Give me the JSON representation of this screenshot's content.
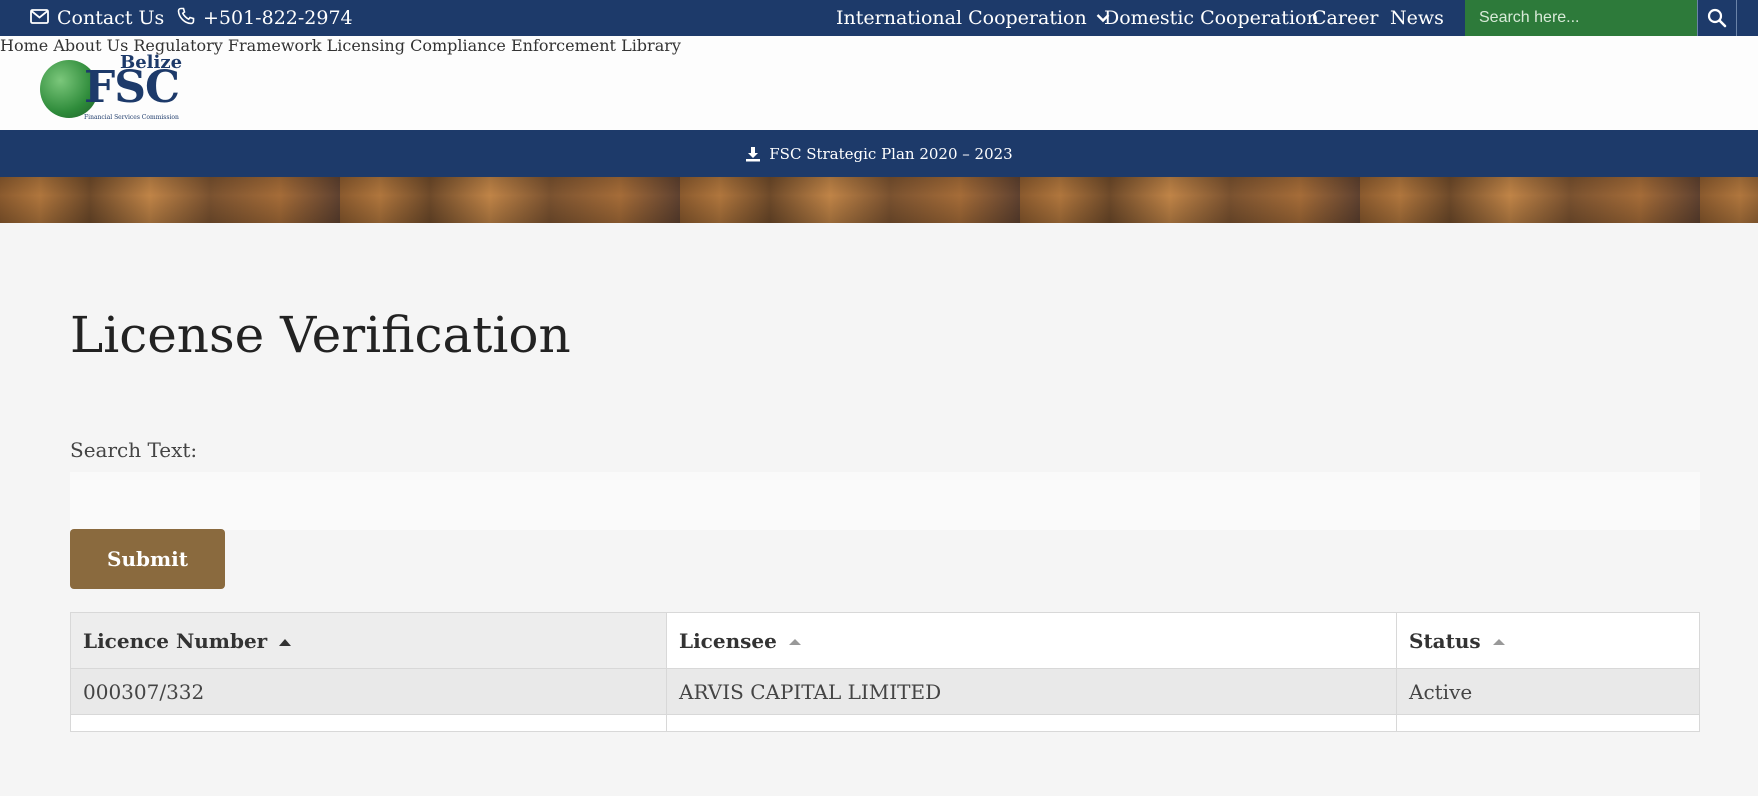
{
  "topbar": {
    "contact_label": "Contact Us",
    "phone": "+501-822-2974",
    "links": [
      "International Cooperation",
      "Domestic Cooperation",
      "Career",
      "News"
    ],
    "search_placeholder": "Search here..."
  },
  "logo": {
    "line1": "Belize",
    "line2": "FSC",
    "line3": "Financial Services Commission"
  },
  "nav": [
    "Home",
    "About Us",
    "Regulatory Framework",
    "Licensing",
    "Compliance",
    "Enforcement",
    "Library"
  ],
  "plan_link": "FSC Strategic Plan 2020 – 2023",
  "page": {
    "title": "License Verification",
    "search_label": "Search Text:",
    "search_value": "",
    "submit_label": "Submit"
  },
  "table": {
    "headers": [
      "Licence Number",
      "Licensee",
      "Status"
    ],
    "rows": [
      [
        "000307/332",
        "ARVIS CAPITAL LIMITED",
        "Active"
      ]
    ]
  },
  "colors": {
    "navy": "#1d3a6a",
    "search_green": "#2d7a3a",
    "submit_brown": "#8a6a3e"
  }
}
